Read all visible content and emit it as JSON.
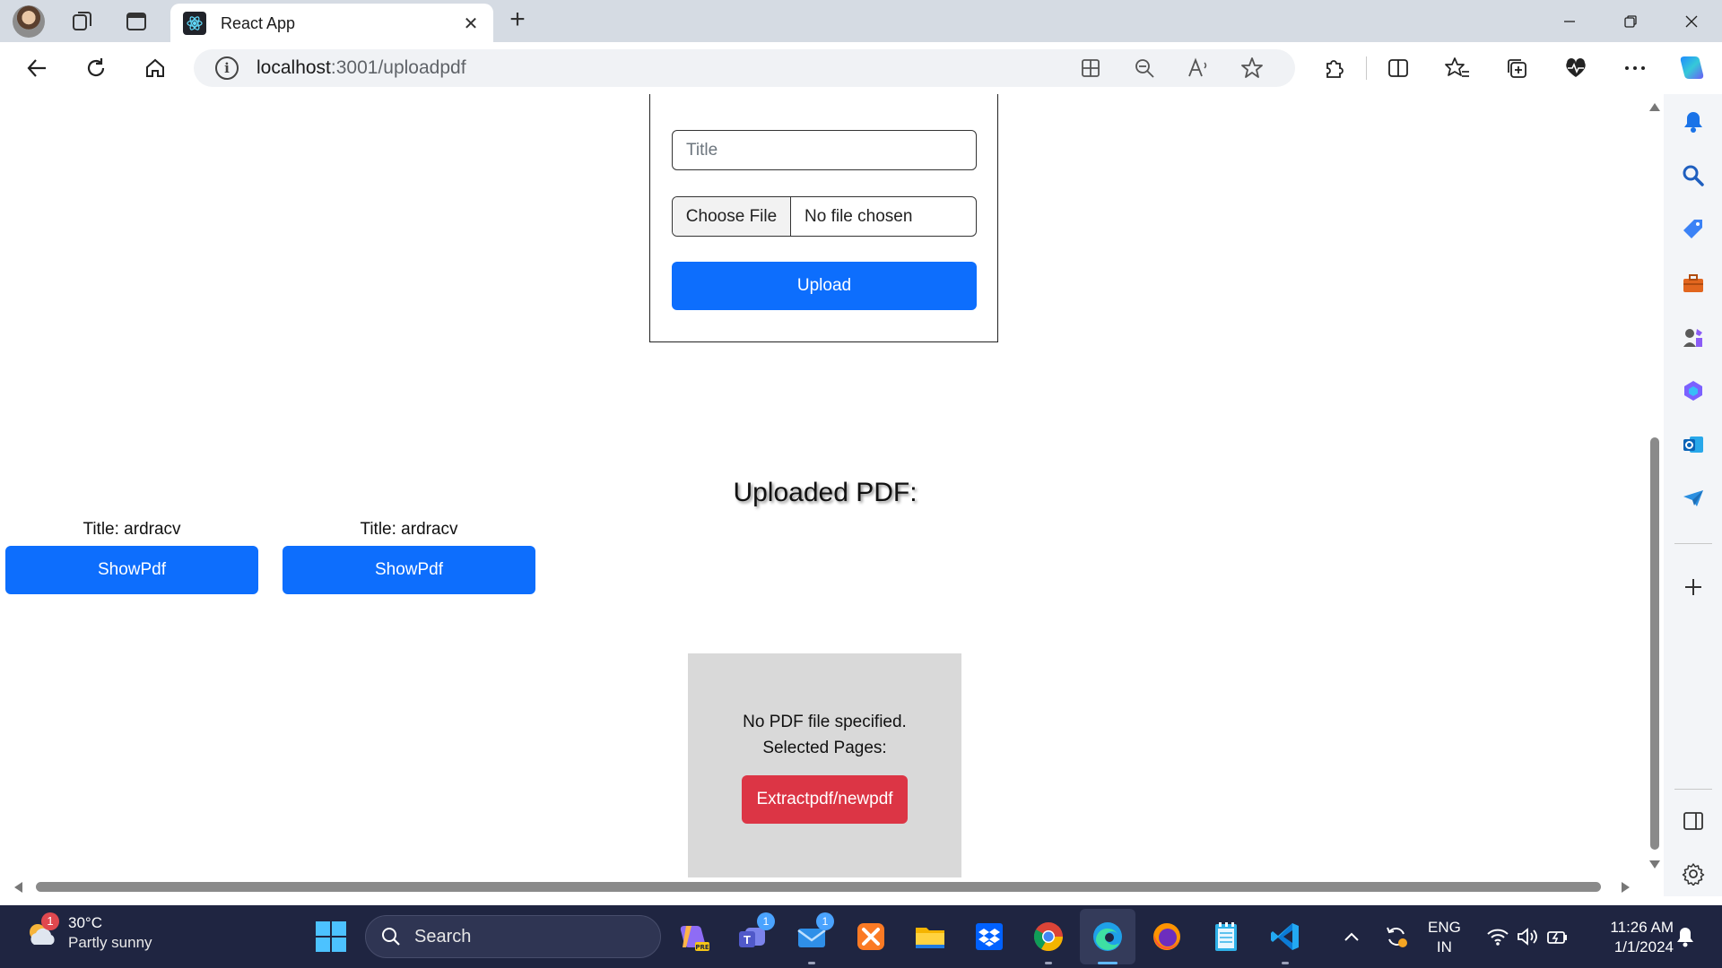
{
  "browser": {
    "tab_title": "React App",
    "url_host": "localhost",
    "url_path": ":3001/uploadpdf"
  },
  "upload_form": {
    "title_placeholder": "Title",
    "title_value": "",
    "choose_file_label": "Choose File",
    "file_status": "No file chosen",
    "upload_label": "Upload"
  },
  "uploaded": {
    "heading": "Uploaded PDF:",
    "items": [
      {
        "title": "Title: ardracv",
        "button": "ShowPdf"
      },
      {
        "title": "Title: ardracv",
        "button": "ShowPdf"
      }
    ]
  },
  "viewer": {
    "message": "No PDF file specified.",
    "pages_label": "Selected Pages:",
    "extract_label": "Extractpdf/newpdf"
  },
  "taskbar": {
    "weather_temp": "30°C",
    "weather_desc": "Partly sunny",
    "weather_badge": "1",
    "search_label": "Search",
    "teams_badge": "1",
    "mail_badge": "1",
    "lang_line1": "ENG",
    "lang_line2": "IN",
    "time": "11:26 AM",
    "date": "1/1/2024"
  },
  "colors": {
    "primary": "#0d6efd",
    "danger": "#dc3545",
    "viewer_bg": "#d9d9d9",
    "taskbar_bg": "#1f2541"
  },
  "icons": {
    "toolbar": [
      "back-icon",
      "refresh-icon",
      "home-icon",
      "info-icon",
      "app-available-icon",
      "zoom-out-icon",
      "read-aloud-icon",
      "favorite-star-icon",
      "extensions-icon",
      "split-screen-icon",
      "favorites-icon",
      "collections-icon",
      "browser-essentials-icon",
      "more-icon",
      "copilot-icon"
    ],
    "sidebar": [
      "bell-icon",
      "search-icon",
      "shopping-tag-icon",
      "tools-icon",
      "games-icon",
      "microsoft-365-icon",
      "outlook-icon",
      "send-icon",
      "add-icon",
      "sidebar-toggle-icon",
      "settings-icon"
    ]
  }
}
